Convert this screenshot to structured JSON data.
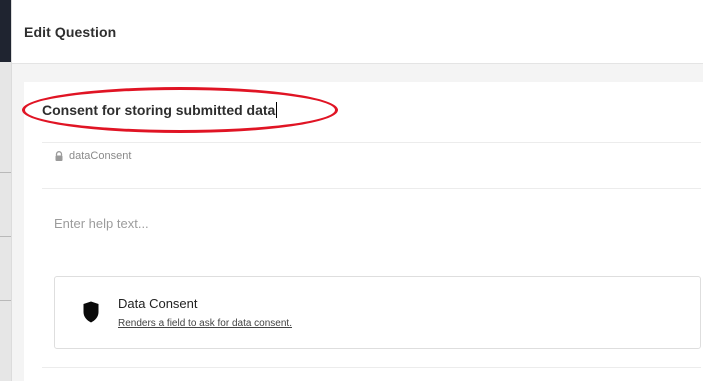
{
  "header": {
    "title": "Edit Question"
  },
  "question": {
    "title": "Consent for storing submitted data",
    "key": "dataConsent",
    "help_placeholder": "Enter help text..."
  },
  "field_type": {
    "name": "Data Consent",
    "description": "Renders a field to ask for data consent.",
    "icon": "shield-icon"
  },
  "colors": {
    "highlight": "#e01424"
  }
}
